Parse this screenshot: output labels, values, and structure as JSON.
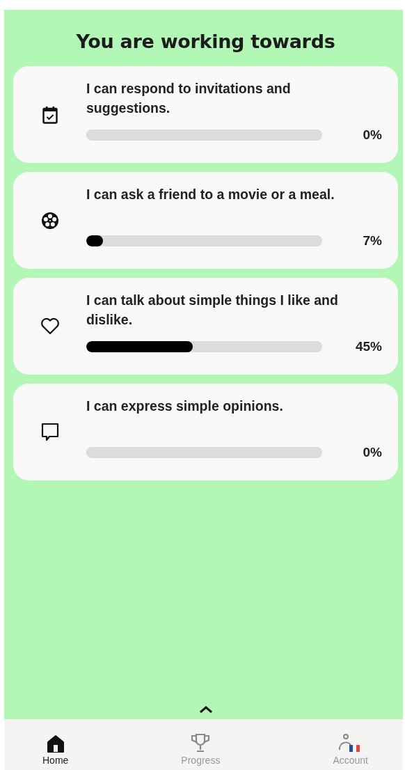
{
  "title": "You are working towards",
  "goals": [
    {
      "kind": "calendar",
      "text": "I can respond to invitations and suggestions.",
      "level": 0,
      "reading": "0%"
    },
    {
      "kind": "film",
      "text": "I can ask a friend to a movie or a meal.",
      "level": 0.07,
      "reading": "7%"
    },
    {
      "kind": "heart",
      "text": "I can talk about simple things I like and dislike.",
      "level": 0.45,
      "reading": "45%"
    },
    {
      "kind": "speech",
      "text": "I can express simple opinions.",
      "level": 0,
      "reading": "0%"
    }
  ],
  "nav": [
    {
      "kind": "home",
      "label": "Home",
      "selected": true
    },
    {
      "kind": "trophy",
      "label": "Progress",
      "selected": false
    },
    {
      "kind": "account",
      "label": "Account",
      "selected": false
    }
  ]
}
